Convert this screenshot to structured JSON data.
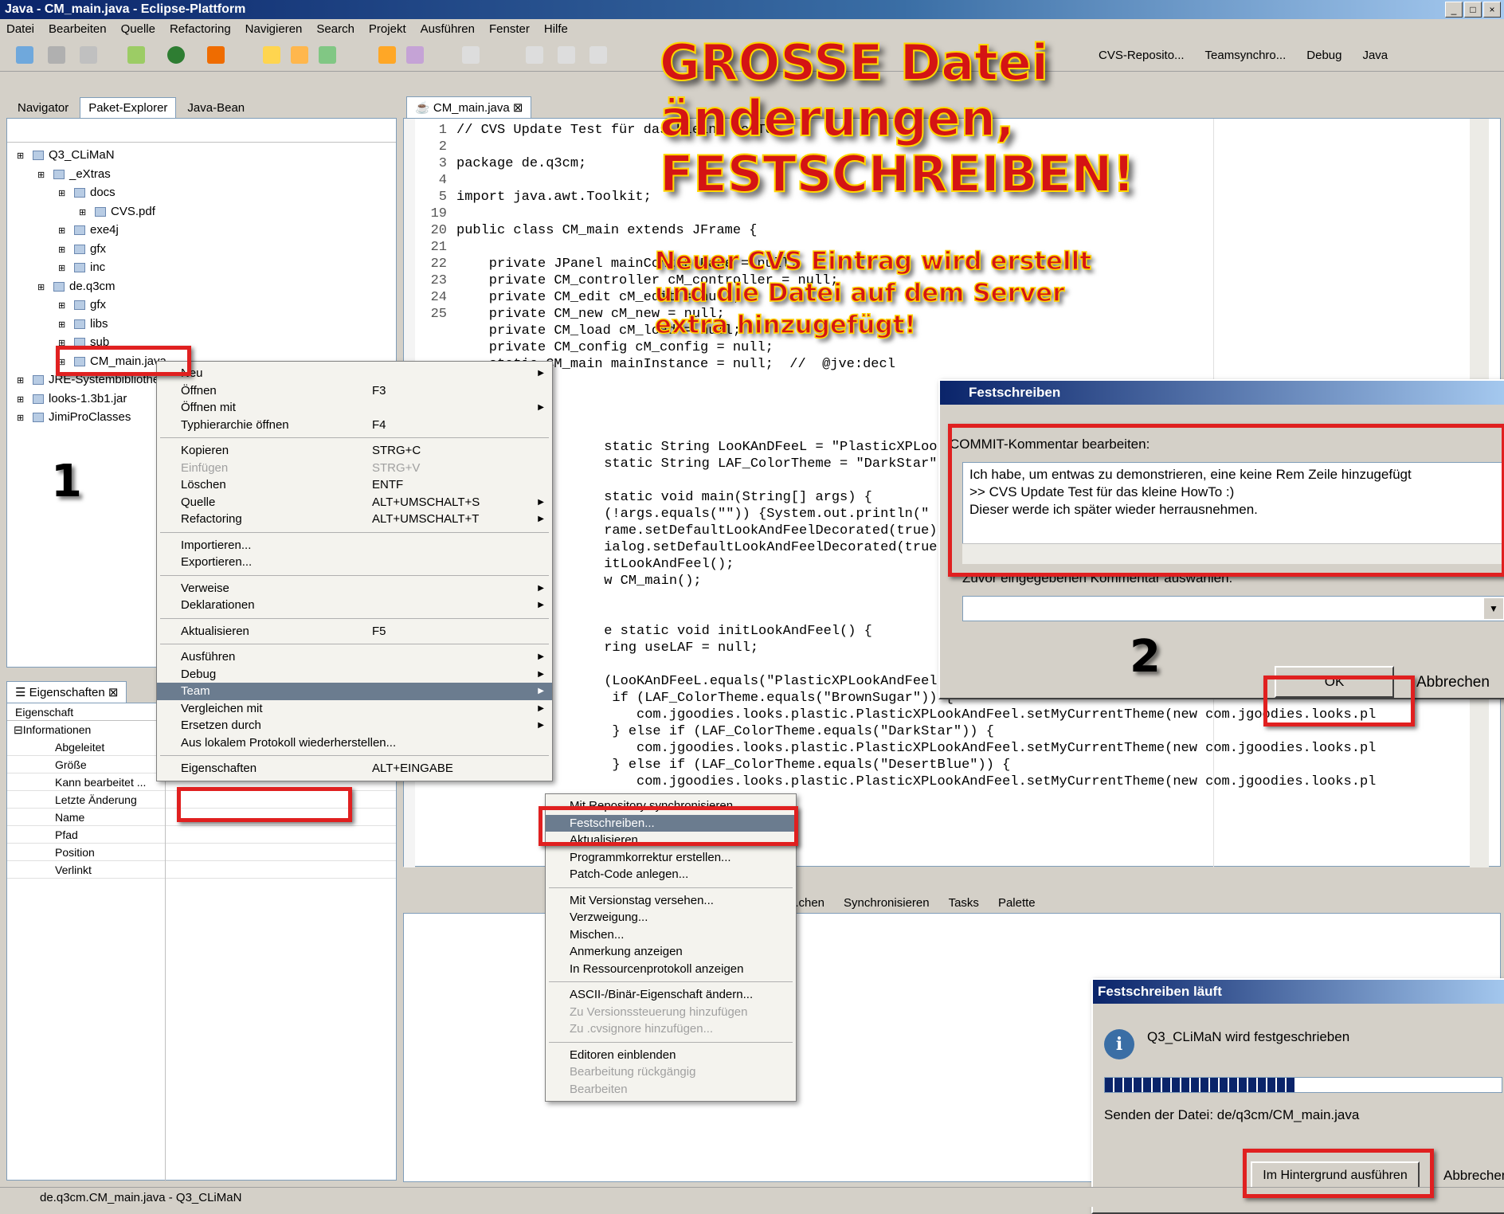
{
  "window": {
    "title": "Java - CM_main.java - Eclipse-Plattform"
  },
  "menubar": [
    "Datei",
    "Bearbeiten",
    "Quelle",
    "Refactoring",
    "Navigieren",
    "Search",
    "Projekt",
    "Ausführen",
    "Fenster",
    "Hilfe"
  ],
  "perspectives": [
    "CVS-Reposito...",
    "Teamsynchro...",
    "Debug",
    "Java"
  ],
  "left_tabs": [
    "Navigator",
    "Paket-Explorer",
    "Java-Bean"
  ],
  "tree": [
    "Q3_CLiMaN",
    "_eXtras",
    "docs",
    "CVS.pdf",
    "exe4j",
    "gfx",
    "inc",
    "de.q3cm",
    "gfx",
    "libs",
    "sub",
    "CM_main.java",
    "JRE-Systembibliothek",
    "looks-1.3b1.jar",
    "JimiProClasses"
  ],
  "editor": {
    "tab": "CM_main.java",
    "lines": [
      {
        "n": "1",
        "t": "// CVS Update Test für das kleine HowTo"
      },
      {
        "n": "2",
        "t": ""
      },
      {
        "n": "3",
        "t": "package de.q3cm;"
      },
      {
        "n": "4",
        "t": ""
      },
      {
        "n": "5",
        "t": "import java.awt.Toolkit;"
      },
      {
        "n": "19",
        "t": ""
      },
      {
        "n": "20",
        "t": "public class CM_main extends JFrame {"
      },
      {
        "n": "21",
        "t": ""
      },
      {
        "n": "22",
        "t": "    private JPanel mainContentPane = null;"
      },
      {
        "n": "23",
        "t": "    private CM_controller cM_controller = null;"
      },
      {
        "n": "24",
        "t": "    private CM_edit cM_edit = null;"
      },
      {
        "n": "25",
        "t": "    private CM_new cM_new = null;"
      },
      {
        "n": "",
        "t": "    private CM_load cM_load = null;"
      },
      {
        "n": "",
        "t": "    private CM_config cM_config = null;"
      },
      {
        "n": "",
        "t": "    static CM_main mainInstance = null;  //  @jve:decl"
      }
    ],
    "lower": [
      "      static String LooKAnDFeeL = \"PlasticXPLookAndFeel\";",
      "      static String LAF_ColorTheme = \"DarkStar\";",
      "",
      "      static void main(String[] args) {",
      "      (!args.equals(\"\")) {System.out.println(\"",
      "      rame.setDefaultLookAndFeelDecorated(true);",
      "      ialog.setDefaultLookAndFeelDecorated(true);",
      "      itLookAndFeel();",
      "      w CM_main();",
      "",
      "",
      "      e static void initLookAndFeel() {",
      "      ring useLAF = null;",
      "",
      "      (LooKAnDFeeL.equals(\"PlasticXPLookAndFeel\") || LooKAnDFeeL.equals(\"Plastic3DLookAndFeel\") || Loo",
      "       if (LAF_ColorTheme.equals(\"BrownSugar\")) {",
      "          com.jgoodies.looks.plastic.PlasticXPLookAndFeel.setMyCurrentTheme(new com.jgoodies.looks.pl",
      "       } else if (LAF_ColorTheme.equals(\"DarkStar\")) {",
      "          com.jgoodies.looks.plastic.PlasticXPLookAndFeel.setMyCurrentTheme(new com.jgoodies.looks.pl",
      "       } else if (LAF_ColorTheme.equals(\"DesertBlue\")) {",
      "          com.jgoodies.looks.plastic.PlasticXPLookAndFeel.setMyCurrentTheme(new com.jgoodies.looks.pl"
    ]
  },
  "overlay": {
    "line1": "GROSSE Datei",
    "line2": "änderungen,",
    "line3": "FESTSCHREIBEN!",
    "sub1": "Neuer CVS Eintrag wird erstellt",
    "sub2": "und die Datei auf dem Server",
    "sub3": "extra hinzugefügt!"
  },
  "context_menu": [
    {
      "l": "Neu",
      "k": "",
      "a": true
    },
    {
      "l": "Öffnen",
      "k": "F3"
    },
    {
      "l": "Öffnen mit",
      "k": "",
      "a": true
    },
    {
      "l": "Typhierarchie öffnen",
      "k": "F4"
    },
    {
      "sep": true
    },
    {
      "l": "Kopieren",
      "k": "STRG+C"
    },
    {
      "l": "Einfügen",
      "k": "STRG+V",
      "d": true
    },
    {
      "l": "Löschen",
      "k": "ENTF"
    },
    {
      "l": "Quelle",
      "k": "ALT+UMSCHALT+S",
      "a": true
    },
    {
      "l": "Refactoring",
      "k": "ALT+UMSCHALT+T",
      "a": true
    },
    {
      "sep": true
    },
    {
      "l": "Importieren...",
      "k": ""
    },
    {
      "l": "Exportieren...",
      "k": ""
    },
    {
      "sep": true
    },
    {
      "l": "Verweise",
      "k": "",
      "a": true
    },
    {
      "l": "Deklarationen",
      "k": "",
      "a": true
    },
    {
      "sep": true
    },
    {
      "l": "Aktualisieren",
      "k": "F5"
    },
    {
      "sep": true
    },
    {
      "l": "Ausführen",
      "k": "",
      "a": true
    },
    {
      "l": "Debug",
      "k": "",
      "a": true
    },
    {
      "l": "Team",
      "k": "",
      "a": true,
      "h": true
    },
    {
      "l": "Vergleichen mit",
      "k": "",
      "a": true
    },
    {
      "l": "Ersetzen durch",
      "k": "",
      "a": true
    },
    {
      "l": "Aus lokalem Protokoll wiederherstellen...",
      "k": ""
    },
    {
      "sep": true
    },
    {
      "l": "Eigenschaften",
      "k": "ALT+EINGABE"
    }
  ],
  "team_menu": [
    {
      "l": "Mit Repository synchronisieren"
    },
    {
      "l": "Festschreiben...",
      "h": true
    },
    {
      "l": "Aktualisieren..."
    },
    {
      "l": "Programmkorrektur erstellen..."
    },
    {
      "l": "Patch-Code anlegen..."
    },
    {
      "sep": true
    },
    {
      "l": "Mit Versionstag versehen..."
    },
    {
      "l": "Verzweigung..."
    },
    {
      "l": "Mischen..."
    },
    {
      "l": "Anmerkung anzeigen"
    },
    {
      "l": "In Ressourcenprotokoll anzeigen"
    },
    {
      "sep": true
    },
    {
      "l": "ASCII-/Binär-Eigenschaft ändern..."
    },
    {
      "l": "Zu Versionssteuerung hinzufügen",
      "d": true
    },
    {
      "l": "Zu .cvsignore hinzufügen...",
      "d": true
    },
    {
      "sep": true
    },
    {
      "l": "Editoren einblenden"
    },
    {
      "l": "Bearbeitung rückgängig",
      "d": true
    },
    {
      "l": "Bearbeiten",
      "d": true
    }
  ],
  "properties": {
    "tab": "Eigenschaften",
    "header": "Eigenschaft",
    "group": "Informationen",
    "rows": [
      "Abgeleitet",
      "Größe",
      "Kann bearbeitet ...",
      "Letzte Änderung",
      "Name",
      "Pfad",
      "Position",
      "Verlinkt"
    ]
  },
  "bottom_tabs": [
    "...chen",
    "Synchronisieren",
    "Tasks",
    "Palette"
  ],
  "commit_dialog": {
    "title": "Festschreiben",
    "label": "COMMIT-Kommentar bearbeiten:",
    "text1": "Ich habe, um entwas zu demonstrieren,  eine keine Rem Zeile hinzugefügt",
    "text2": ">> CVS Update Test für das kleine HowTo :)",
    "text3": "Dieser werde ich später wieder herrausnehmen.",
    "prev_label": "Zuvor eingegebenen Kommentar auswählen:",
    "ok": "OK",
    "cancel": "Abbrechen"
  },
  "progress_dialog": {
    "title": "Festschreiben läuft",
    "message": "Q3_CLiMaN wird festgeschrieben",
    "progress": 0.48,
    "status": "Senden der Datei: de/q3cm/CM_main.java",
    "bg_button": "Im Hintergrund ausführen",
    "cancel": "Abbrechen"
  },
  "markers": {
    "one": "1",
    "two": "2"
  },
  "statusbar": "de.q3cm.CM_main.java - Q3_CLiMaN"
}
